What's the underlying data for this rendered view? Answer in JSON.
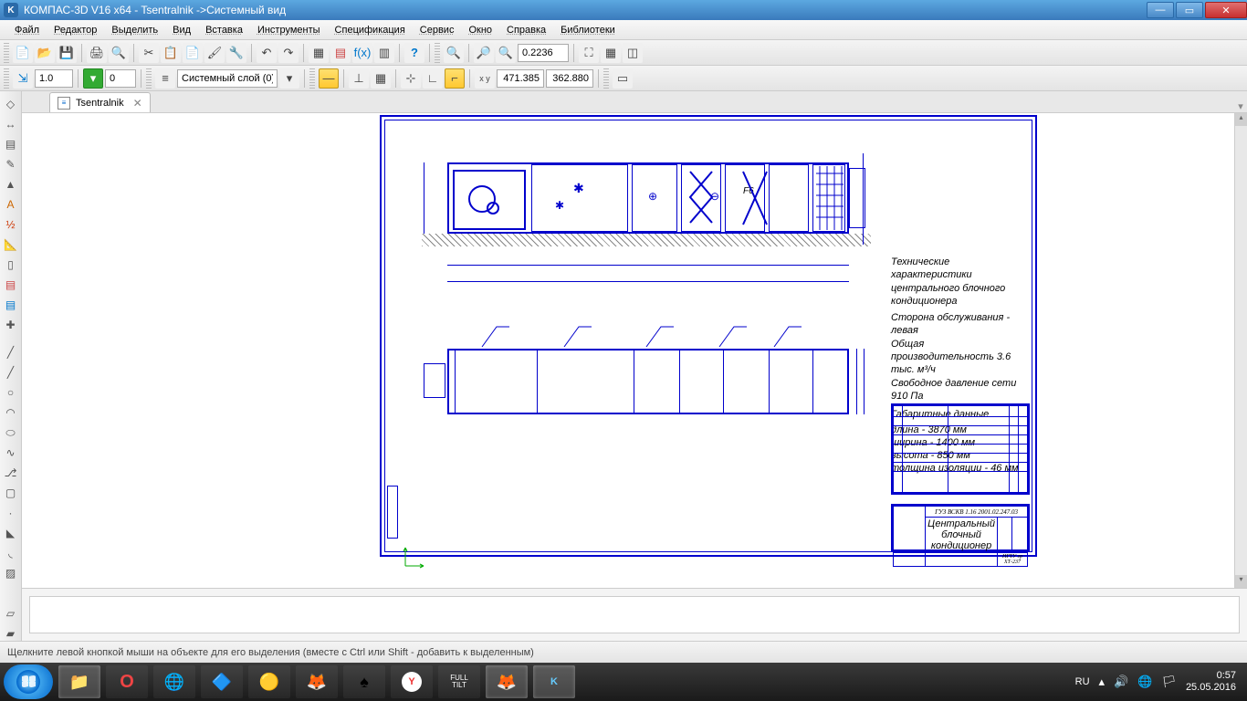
{
  "window": {
    "title": "КОМПАС-3D V16  x64 - Tsentralnik ->Системный вид"
  },
  "menu": [
    "Файл",
    "Редактор",
    "Выделить",
    "Вид",
    "Вставка",
    "Инструменты",
    "Спецификация",
    "Сервис",
    "Окно",
    "Справка",
    "Библиотеки"
  ],
  "toolbar2": {
    "scale": "1.0",
    "layer_num": "0",
    "layer_name": "Системный слой (0)",
    "zoom_value": "0.2236",
    "coord_x": "471.385",
    "coord_y": "362.880"
  },
  "tab": {
    "label": "Tsentralnik"
  },
  "notes": {
    "title": "Технические характеристики центрального блочного кондиционера",
    "l1": "Сторона обслуживания - левая",
    "l2": "Общая производительность 3.6 тыс. м³/ч",
    "l3": "Свободное давление сети 910 Па",
    "h2": "Габаритные данные",
    "l4": "длина - 3870 мм",
    "l5": "ширина - 1400 мм",
    "l6": "высота - 850 мм",
    "l7": "толщина изоляции - 46 мм"
  },
  "titleblock": {
    "code": "ГУЗ ВСКВ 1.16 2001.02.247.03",
    "name1": "Центральный блочный",
    "name2": "кондиционер",
    "org": "НГТУ гр ХТ-237"
  },
  "status": "Щелкните левой кнопкой мыши на объекте для его выделения (вместе с Ctrl или Shift - добавить к выделенным)",
  "tray": {
    "lang": "RU",
    "time": "0:57",
    "date": "25.05.2016"
  }
}
